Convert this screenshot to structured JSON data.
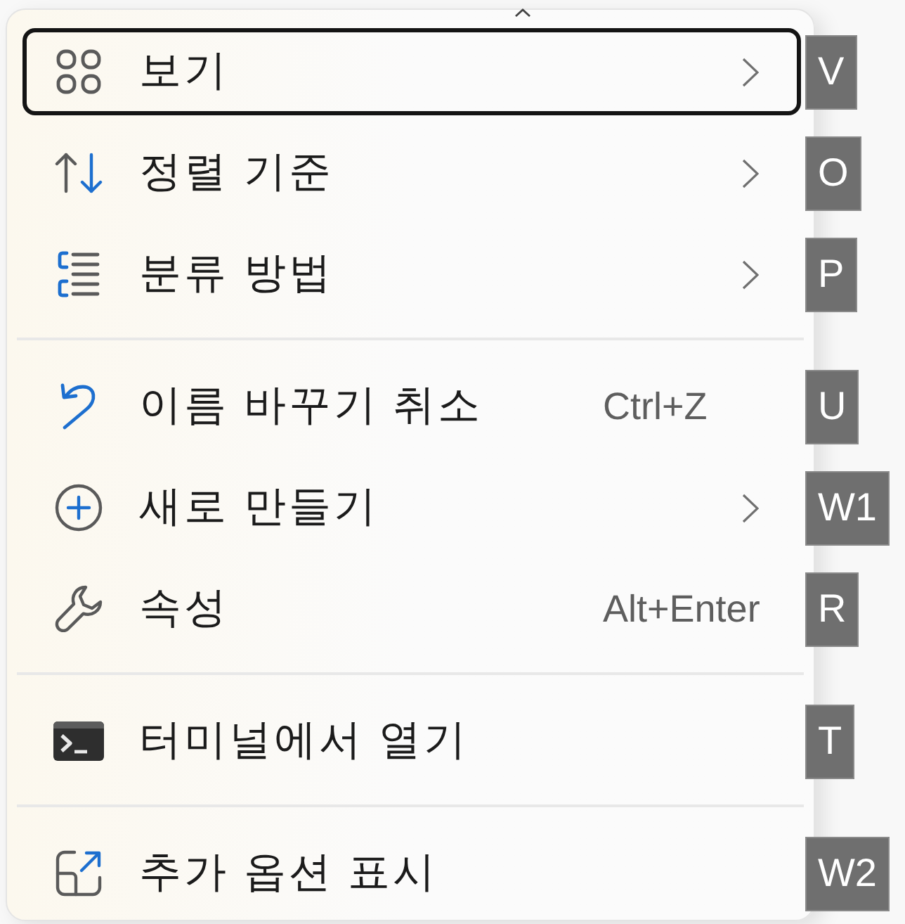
{
  "menu": {
    "sections": [
      {
        "items": [
          {
            "label": "보기",
            "focused": true,
            "submenu": true,
            "access_key": "V"
          },
          {
            "label": "정렬 기준",
            "focused": false,
            "submenu": true,
            "access_key": "O"
          },
          {
            "label": "분류 방법",
            "focused": false,
            "submenu": true,
            "access_key": "P"
          }
        ]
      },
      {
        "items": [
          {
            "label": "이름 바꾸기 취소",
            "focused": false,
            "submenu": false,
            "shortcut": "Ctrl+Z",
            "access_key": "U"
          },
          {
            "label": "새로 만들기",
            "focused": false,
            "submenu": true,
            "access_key": "W1"
          },
          {
            "label": "속성",
            "focused": false,
            "submenu": false,
            "shortcut": "Alt+Enter",
            "access_key": "R"
          }
        ]
      },
      {
        "items": [
          {
            "label": "터미널에서 열기",
            "focused": false,
            "submenu": false,
            "access_key": "T"
          }
        ]
      },
      {
        "items": [
          {
            "label": "추가 옵션 표시",
            "focused": false,
            "submenu": false,
            "access_key": "W2"
          }
        ]
      }
    ]
  }
}
